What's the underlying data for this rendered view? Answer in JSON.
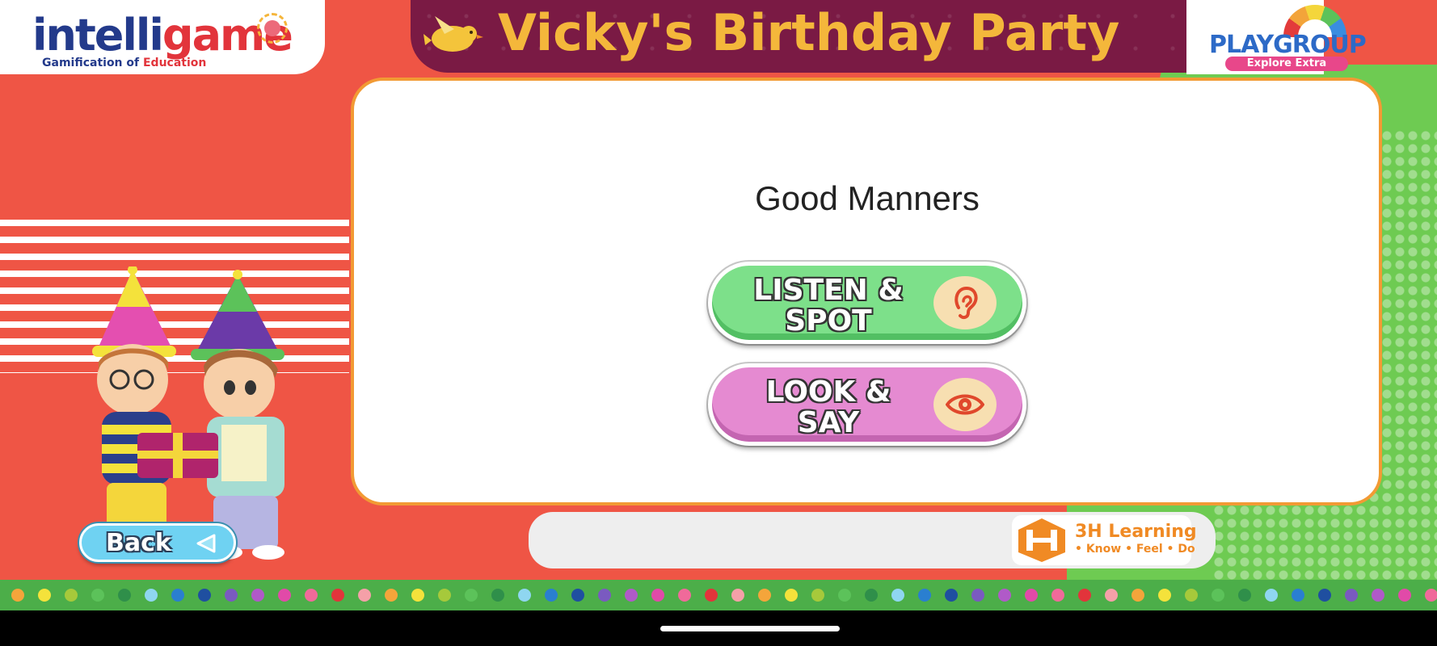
{
  "header": {
    "brand_left": {
      "name_part1": "intelli",
      "name_part2": "game",
      "tagline_part1": "Gamification of",
      "tagline_part2": "Education"
    },
    "title": "Vicky's Birthday Party",
    "brand_right": {
      "name": "PLAYGROUP",
      "badge": "Explore Extra"
    }
  },
  "main": {
    "heading": "Good Manners",
    "activities": [
      {
        "line1": "LISTEN &",
        "line2": "SPOT",
        "icon": "ear-icon"
      },
      {
        "line1": "LOOK &",
        "line2": "SAY",
        "icon": "eye-icon"
      }
    ]
  },
  "footer": {
    "brand_name": "3H Learning",
    "brand_tagline": "• Know • Feel • Do"
  },
  "back_button": {
    "label": "Back",
    "icon": "back-arrow-icon"
  },
  "colors": {
    "background_red": "#ef5545",
    "background_green": "#6ecb52",
    "title_banner": "#7a1a44",
    "title_text": "#f4b73b",
    "card_border": "#f29a34",
    "listen_button": "#7de08a",
    "look_button": "#e58ad1",
    "back_button": "#6fd2f2"
  }
}
